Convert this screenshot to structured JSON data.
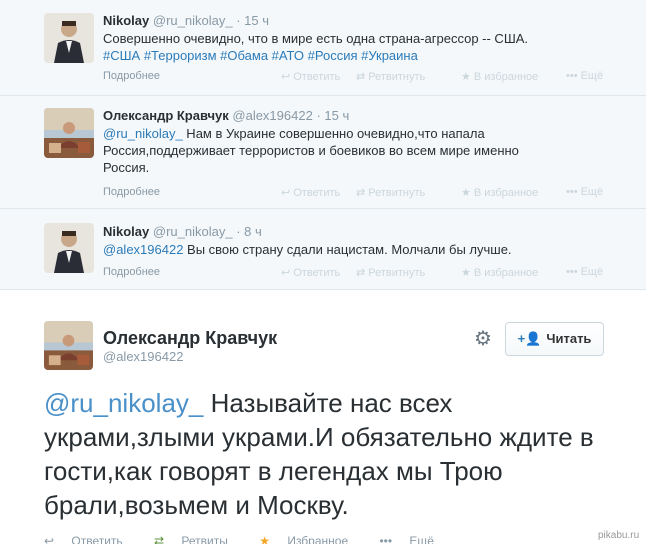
{
  "thread": [
    {
      "name": "Nikolay",
      "handle": "@ru_nikolay_",
      "dot": "·",
      "time": "15 ч",
      "text": "Совершенно очевидно, что в мире есть одна страна-агрессор -- США.",
      "hashtags": "#США #Терроризм #Обама #АТО #Россия #Украина",
      "more": "Подробнее"
    },
    {
      "name": "Олександр Кравчук",
      "handle": "@alex196422",
      "dot": "·",
      "time": "15 ч",
      "mention": "@ru_nikolay_",
      "text": " Нам в Украине совершенно очевидно,что напала Россия,поддерживает террористов и боевиков во всем мире именно Россия.",
      "more": "Подробнее"
    },
    {
      "name": "Nikolay",
      "handle": "@ru_nikolay_",
      "dot": "·",
      "time": "8 ч",
      "mention": "@alex196422",
      "text": " Вы свою страну сдали нацистам. Молчали бы лучше.",
      "more": "Подробнее"
    }
  ],
  "actions": {
    "reply": "Ответить",
    "retweet": "Ретвитнуть",
    "favorite": "В избранное",
    "more": "Ещё"
  },
  "main": {
    "name": "Олександр Кравчук",
    "handle": "@alex196422",
    "follow": "Читать",
    "mention": "@ru_nikolay_",
    "text": " Называйте нас всех украми,злыми украми.И обязательно ждите в гости,как говорят в легендах мы Трою брали,возьмем и Москву.",
    "actions": {
      "reply": "Ответить",
      "retweet": "Ретвиты",
      "favorite": "Избранное",
      "more": "Ещё"
    }
  },
  "watermark": "pikabu.ru",
  "colors": {
    "link": "#2b7bb9",
    "muted": "#8899a6",
    "thread_bg": "#f5f8fa"
  }
}
